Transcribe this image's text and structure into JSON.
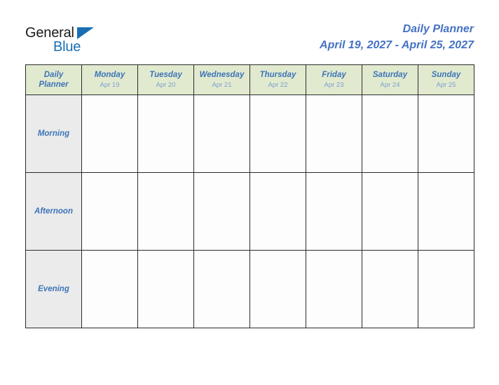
{
  "logo": {
    "word1": "General",
    "word2": "Blue",
    "triangle_color": "#1a6fb4",
    "word1_color": "#1a1a1a",
    "word2_color": "#1a6fb4",
    "triangle_icon": "triangle-right-icon"
  },
  "header": {
    "title": "Daily Planner",
    "date_range": "April 19, 2027 - April 25, 2027",
    "title_color": "#4472c4"
  },
  "planner": {
    "corner_label_line1": "Daily",
    "corner_label_line2": "Planner",
    "header_background": "#e1eacf",
    "row_label_background": "#ebebeb",
    "cell_background": "#fdfdfd",
    "border_color": "#2b2b2b",
    "day_text_color": "#3d74b8",
    "date_text_color": "#7b9ed1",
    "columns": [
      {
        "day": "Monday",
        "date": "Apr 19"
      },
      {
        "day": "Tuesday",
        "date": "Apr 20"
      },
      {
        "day": "Wednesday",
        "date": "Apr 21"
      },
      {
        "day": "Thursday",
        "date": "Apr 22"
      },
      {
        "day": "Friday",
        "date": "Apr 23"
      },
      {
        "day": "Saturday",
        "date": "Apr 24"
      },
      {
        "day": "Sunday",
        "date": "Apr 25"
      }
    ],
    "rows": [
      {
        "label": "Morning",
        "cells": [
          "",
          "",
          "",
          "",
          "",
          "",
          ""
        ]
      },
      {
        "label": "Afternoon",
        "cells": [
          "",
          "",
          "",
          "",
          "",
          "",
          ""
        ]
      },
      {
        "label": "Evening",
        "cells": [
          "",
          "",
          "",
          "",
          "",
          "",
          ""
        ]
      }
    ]
  }
}
